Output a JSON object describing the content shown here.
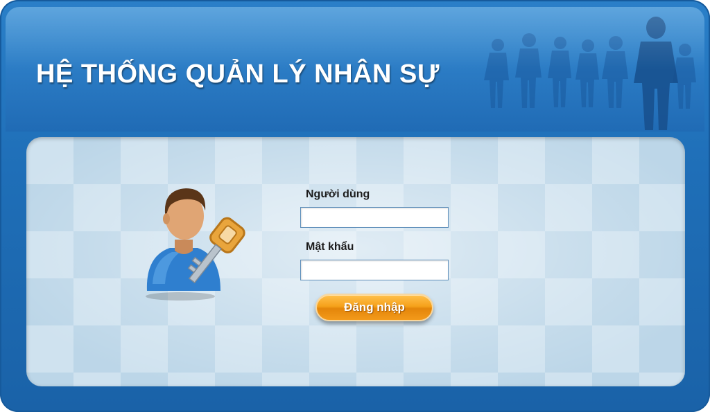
{
  "header": {
    "title": "HỆ THỐNG QUẢN LÝ NHÂN SỰ"
  },
  "login": {
    "username_label": "Người dùng",
    "username_value": "",
    "password_label": "Mật khẩu",
    "password_value": "",
    "submit_label": "Đăng nhập"
  },
  "icons": {
    "header_art": "people-silhouettes-icon",
    "user_art": "user-with-key-icon"
  },
  "colors": {
    "frame_blue": "#1f6fb8",
    "header_blue": "#2a7ac3",
    "button_orange": "#f6a21b",
    "panel_light": "#cfe2ef"
  }
}
